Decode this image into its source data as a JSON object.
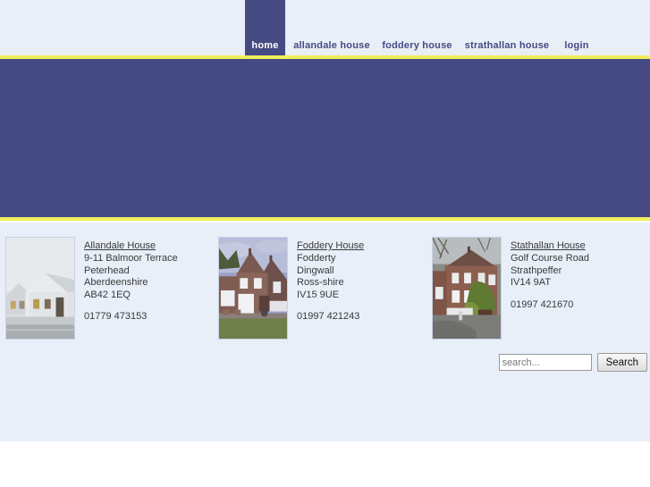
{
  "nav": {
    "items": [
      {
        "label": "home",
        "name": "nav-home",
        "active": true
      },
      {
        "label": "allandale house",
        "name": "nav-allandale",
        "active": false
      },
      {
        "label": "foddery house",
        "name": "nav-foddery",
        "active": false
      },
      {
        "label": "strathallan house",
        "name": "nav-strathallan",
        "active": false
      },
      {
        "label": "login",
        "name": "nav-login",
        "active": false
      }
    ]
  },
  "colors": {
    "banner": "#454a82",
    "accent_rule": "#f2ee5a",
    "page_background": "#e8eff9",
    "nav_text": "#454a82",
    "active_nav_text": "#ffffff",
    "body_text": "#3a3a3a"
  },
  "listings": [
    {
      "name": "Allandale House",
      "image": "photo-allandale-house",
      "address": [
        "9-11 Balmoor Terrace",
        "Peterhead",
        "Aberdeenshire",
        "AB42 1EQ"
      ],
      "phone": "01779 473153"
    },
    {
      "name": "Foddery House",
      "image": "photo-foddery-house",
      "address": [
        "Fodderty",
        "Dingwall",
        "Ross-shire",
        "IV15 9UE"
      ],
      "phone": "01997 421243"
    },
    {
      "name": "Stathallan House",
      "image": "photo-stathallan-house",
      "address": [
        "Golf Course Road",
        "Strathpeffer",
        "IV14 9AT"
      ],
      "phone": "01997 421670"
    }
  ],
  "search": {
    "placeholder": "search...",
    "value": "",
    "button_label": "Search"
  }
}
